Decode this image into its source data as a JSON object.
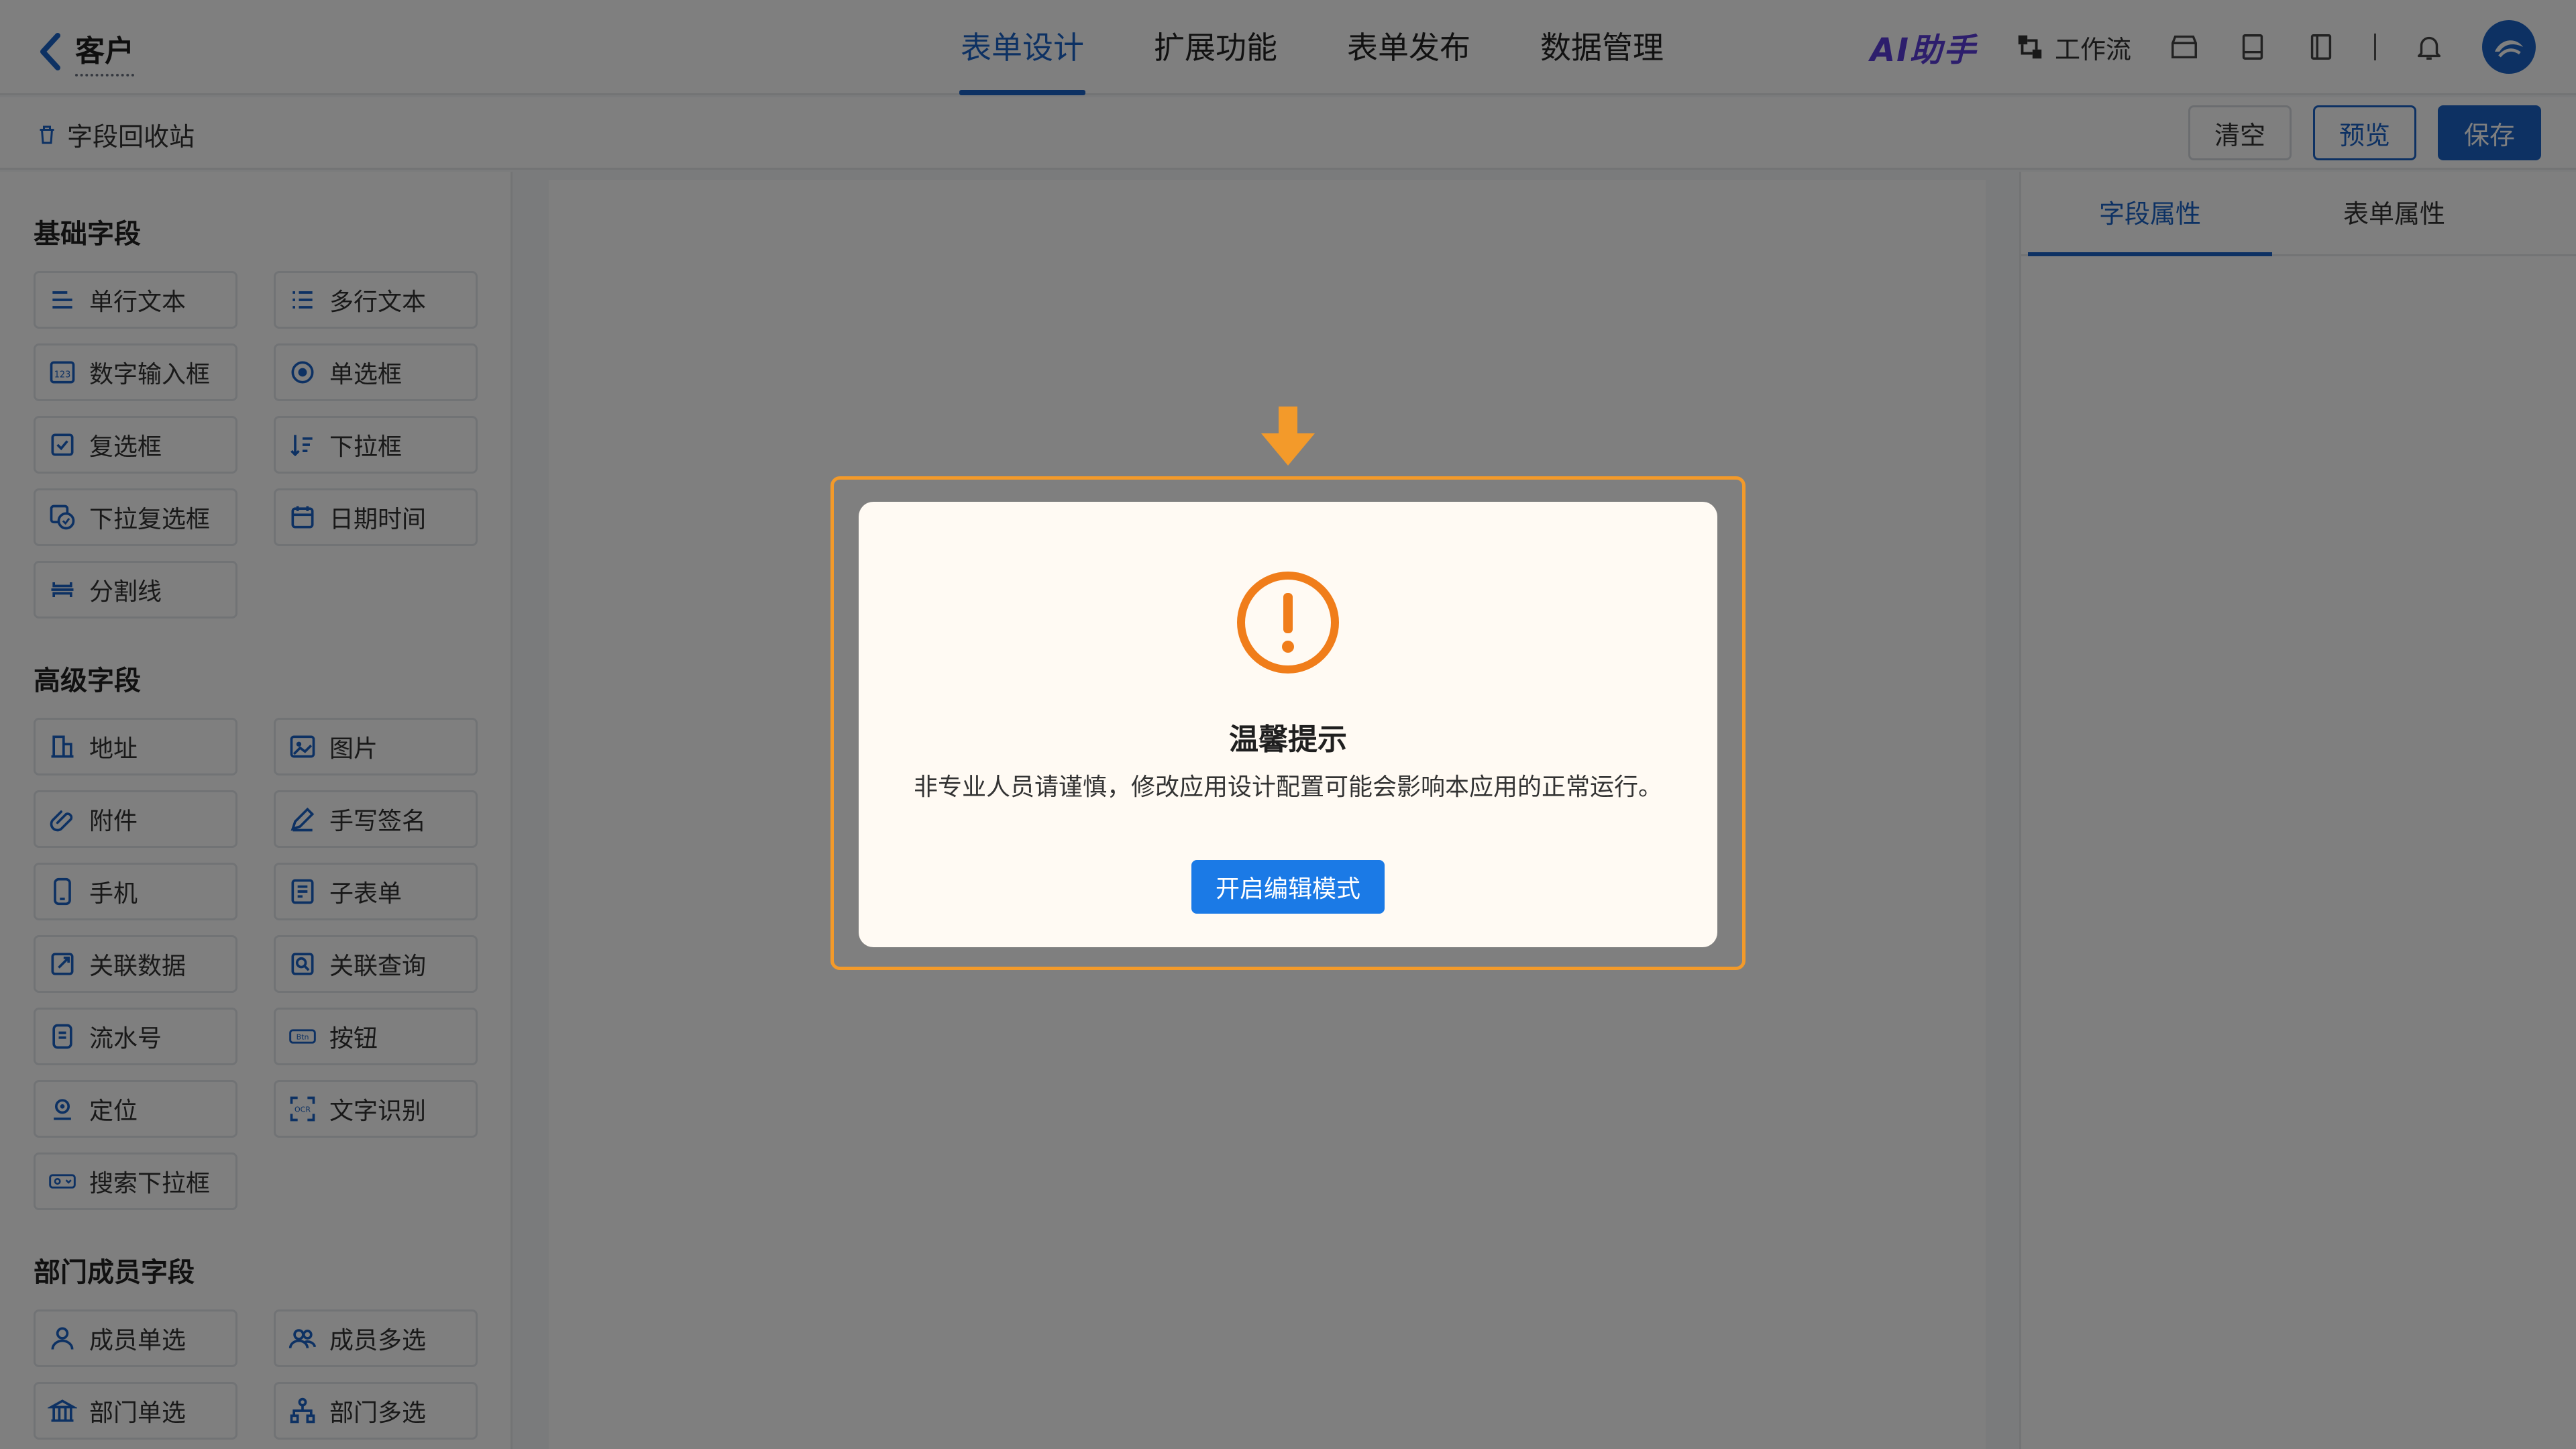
{
  "header": {
    "back_title": "客户",
    "tabs": [
      {
        "label": "表单设计",
        "active": true
      },
      {
        "label": "扩展功能"
      },
      {
        "label": "表单发布"
      },
      {
        "label": "数据管理"
      }
    ],
    "ai_label": "AI助手",
    "workflow_label": "工作流"
  },
  "toolbar": {
    "recycle_label": "字段回收站",
    "clear_label": "清空",
    "preview_label": "预览",
    "save_label": "保存"
  },
  "palette": {
    "basic_title": "基础字段",
    "basic": [
      {
        "label": "单行文本",
        "icon": "single-line-text-icon"
      },
      {
        "label": "多行文本",
        "icon": "multi-line-text-icon"
      },
      {
        "label": "数字输入框",
        "icon": "number-input-icon"
      },
      {
        "label": "单选框",
        "icon": "radio-icon"
      },
      {
        "label": "复选框",
        "icon": "checkbox-icon"
      },
      {
        "label": "下拉框",
        "icon": "dropdown-icon"
      },
      {
        "label": "下拉复选框",
        "icon": "dropdown-checkbox-icon"
      },
      {
        "label": "日期时间",
        "icon": "calendar-icon"
      },
      {
        "label": "分割线",
        "icon": "divider-icon"
      }
    ],
    "advanced_title": "高级字段",
    "advanced": [
      {
        "label": "地址",
        "icon": "address-icon"
      },
      {
        "label": "图片",
        "icon": "image-icon"
      },
      {
        "label": "附件",
        "icon": "attachment-icon"
      },
      {
        "label": "手写签名",
        "icon": "signature-icon"
      },
      {
        "label": "手机",
        "icon": "phone-icon"
      },
      {
        "label": "子表单",
        "icon": "subform-icon"
      },
      {
        "label": "关联数据",
        "icon": "linked-data-icon"
      },
      {
        "label": "关联查询",
        "icon": "linked-query-icon"
      },
      {
        "label": "流水号",
        "icon": "serial-number-icon"
      },
      {
        "label": "按钮",
        "icon": "button-icon"
      },
      {
        "label": "定位",
        "icon": "location-icon"
      },
      {
        "label": "文字识别",
        "icon": "ocr-icon"
      },
      {
        "label": "搜索下拉框",
        "icon": "search-dropdown-icon"
      }
    ],
    "dept_title": "部门成员字段",
    "dept": [
      {
        "label": "成员单选",
        "icon": "member-single-icon"
      },
      {
        "label": "成员多选",
        "icon": "member-multi-icon"
      },
      {
        "label": "部门单选",
        "icon": "dept-single-icon"
      },
      {
        "label": "部门多选",
        "icon": "dept-multi-icon"
      }
    ]
  },
  "right_panel": {
    "tabs": [
      {
        "label": "字段属性",
        "active": true
      },
      {
        "label": "表单属性"
      }
    ]
  },
  "modal": {
    "title": "温馨提示",
    "message": "非专业人员请谨慎，修改应用设计配置可能会影响本应用的正常运行。",
    "button_label": "开启编辑模式"
  },
  "colors": {
    "primary": "#1b63c6",
    "highlight": "#f39a2a",
    "warning": "#f07d1a"
  }
}
